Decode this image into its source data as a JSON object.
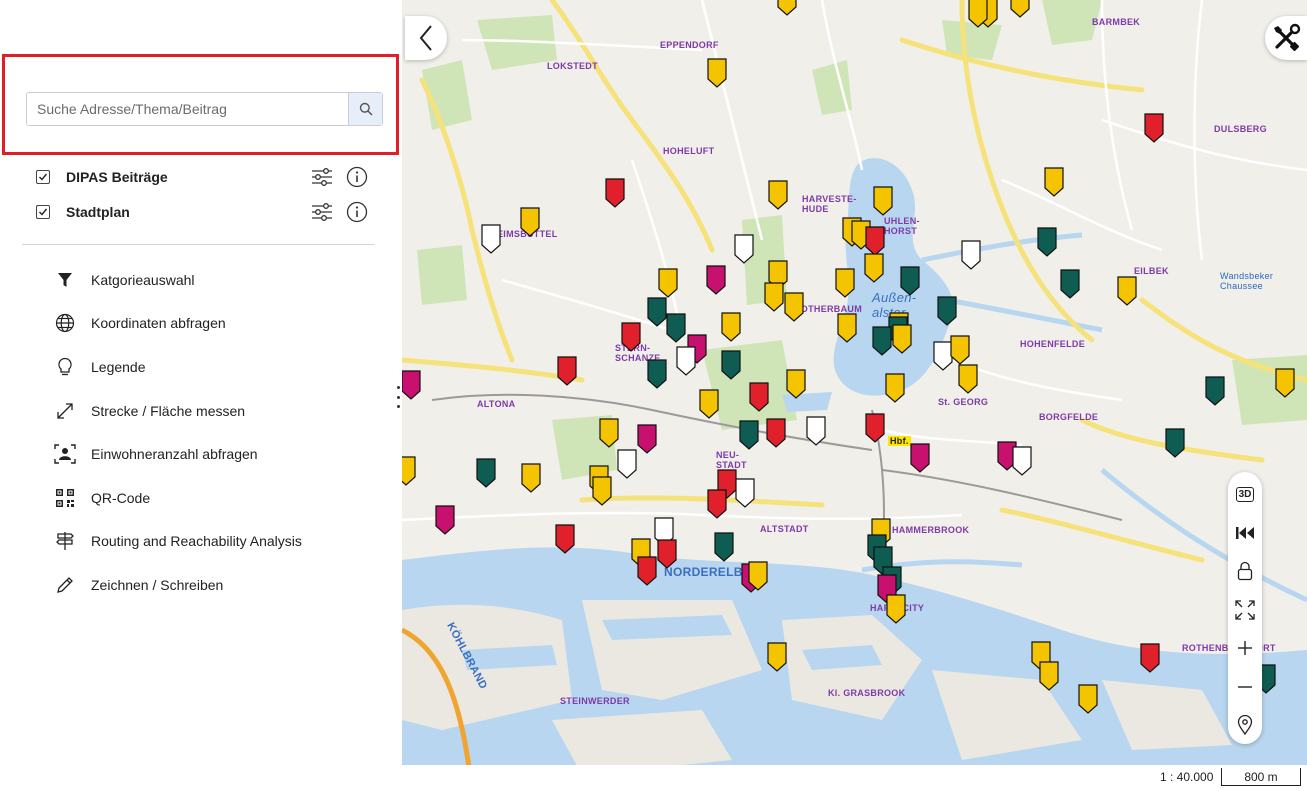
{
  "search": {
    "placeholder": "Suche Adresse/Thema/Beitrag"
  },
  "layers": [
    {
      "label": "DIPAS Beiträge"
    },
    {
      "label": "Stadtplan"
    }
  ],
  "menu": [
    {
      "label": "Katgorieauswahl",
      "icon": "filter-icon"
    },
    {
      "label": "Koordinaten abfragen",
      "icon": "globe-icon"
    },
    {
      "label": "Legende",
      "icon": "lightbulb-icon"
    },
    {
      "label": "Strecke / Fläche messen",
      "icon": "measure-icon"
    },
    {
      "label": "Einwohneranzahl abfragen",
      "icon": "population-icon"
    },
    {
      "label": "QR-Code",
      "icon": "qr-code-icon"
    },
    {
      "label": "Routing and Reachability Analysis",
      "icon": "signpost-icon"
    },
    {
      "label": "Zeichnen / Schreiben",
      "icon": "pencil-icon"
    }
  ],
  "map_labels": {
    "lokstedt": "LOKSTEDT",
    "eppendorf": "EPPENDORF",
    "barmbek": "BARMBEK",
    "dulsberg": "DULSBERG",
    "hoheluft": "HOHELUFT",
    "harvestehude": "HARVESTE-\nHUDE",
    "uhlenhorst": "UHLEN-\nHORST",
    "eilbek": "EILBEK",
    "eimsbuettel": "EIMSBÜTTEL",
    "rotherbaum": "ROTHERBAUM",
    "sternschanze": "STERN-\nSCHANZE",
    "hohenfelde": "HOHENFELDE",
    "altona": "ALTONA",
    "st_georg": "St. GEORG",
    "borgfelde": "BORGFELDE",
    "neustadt": "NEU-\nSTADT",
    "altstadt": "ALTSTADT",
    "hammerbrook": "HAMMERBROOK",
    "hafencity": "HAFENCITY",
    "rothenburg": "ROTHENBURGSORT",
    "kl_grasbrook": "Kl. GRASBROOK",
    "steinwerder": "STEINWERDER",
    "norderelbe": "NORDERELBE",
    "koehlbrand": "KÖHLBRAND",
    "aussenalster": "Außen-\nalster",
    "wandsbeker_chaussee": "Wandsbeker\nChaussee",
    "hbf": "Hbf."
  },
  "markers": {
    "colors": {
      "yellow": "#f5c400",
      "red": "#e0202a",
      "teal": "#0f5c52",
      "magenta": "#c8106e",
      "white": "#ffffff"
    },
    "count": 130
  },
  "controls": [
    "3d-button",
    "rewind-button",
    "lock-button",
    "fullscreen-button",
    "zoom-in-button",
    "zoom-out-button",
    "locate-button"
  ],
  "controls_labels": {
    "three_d": "3D"
  },
  "scale": {
    "ratio": "1 : 40.000",
    "bar": "800 m"
  }
}
